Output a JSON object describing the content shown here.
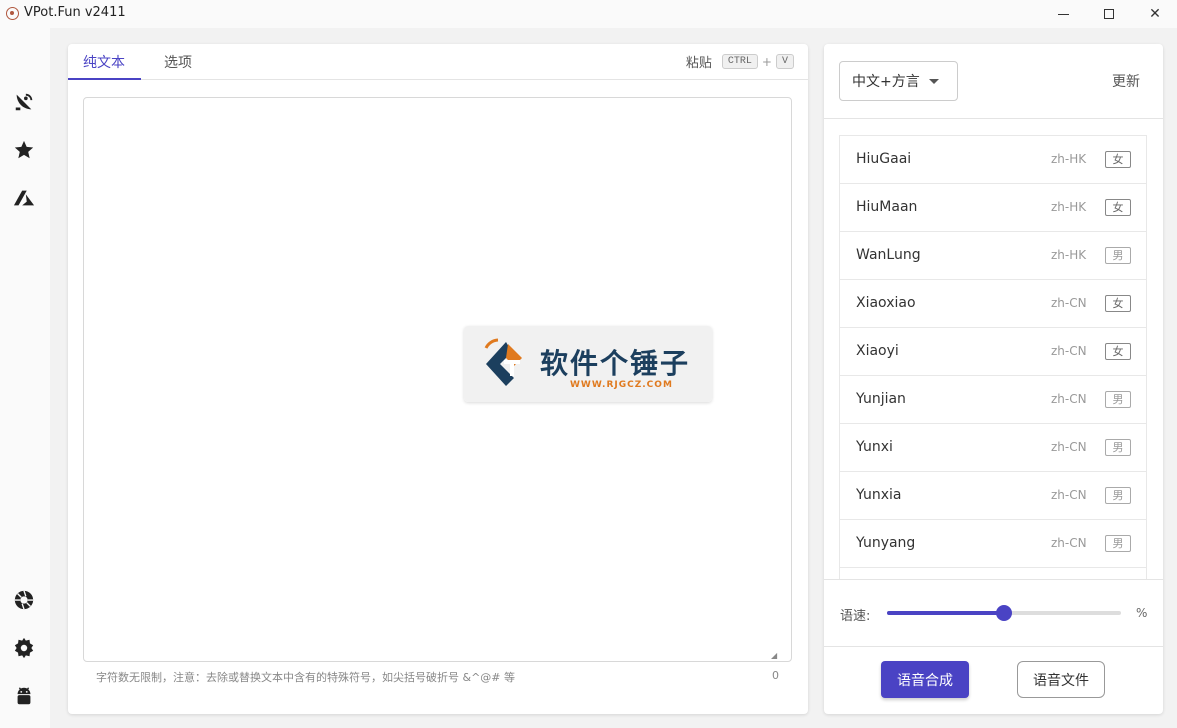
{
  "window": {
    "title": "VPot.Fun v2411",
    "minimize_glyph": "",
    "close_glyph": "✕"
  },
  "sidebar": {
    "top_items": [
      {
        "icon": "satellite-dish-icon"
      },
      {
        "icon": "star-icon"
      },
      {
        "icon": "azure-icon"
      }
    ],
    "bottom_items": [
      {
        "icon": "aperture-icon"
      },
      {
        "icon": "gear-icon"
      },
      {
        "icon": "android-icon"
      }
    ]
  },
  "editor": {
    "tabs": [
      {
        "label": "纯文本",
        "active": true
      },
      {
        "label": "选项",
        "active": false
      }
    ],
    "paste_label": "粘贴",
    "paste_key1": "CTRL",
    "paste_plus": "+",
    "paste_key2": "V",
    "text_value": "",
    "hint": "字符数无限制，注意：去除或替换文本中含有的特殊符号，如尖括号破折号 &^@# 等",
    "char_count": "0",
    "resize_glyph": "◢"
  },
  "watermark": {
    "title": "软件个锤子",
    "url": "WWW.RJGCZ.COM"
  },
  "voices_panel": {
    "language_selected": "中文+方言",
    "refresh_label": "更新",
    "voices": [
      {
        "name": "HiuGaai",
        "locale": "zh-HK",
        "gender": "女"
      },
      {
        "name": "HiuMaan",
        "locale": "zh-HK",
        "gender": "女"
      },
      {
        "name": "WanLung",
        "locale": "zh-HK",
        "gender": "男"
      },
      {
        "name": "Xiaoxiao",
        "locale": "zh-CN",
        "gender": "女"
      },
      {
        "name": "Xiaoyi",
        "locale": "zh-CN",
        "gender": "女"
      },
      {
        "name": "Yunjian",
        "locale": "zh-CN",
        "gender": "男"
      },
      {
        "name": "Yunxi",
        "locale": "zh-CN",
        "gender": "男"
      },
      {
        "name": "Yunxia",
        "locale": "zh-CN",
        "gender": "男"
      },
      {
        "name": "Yunyang",
        "locale": "zh-CN",
        "gender": "男"
      }
    ],
    "speed_label": "语速:",
    "speed_fraction": 0.5,
    "speed_unit": "%",
    "synth_button": "语音合成",
    "file_button": "语音文件"
  },
  "colors": {
    "accent": "#4a43c4",
    "logo_blue": "#1c3f5e",
    "logo_orange": "#e07a1f"
  }
}
